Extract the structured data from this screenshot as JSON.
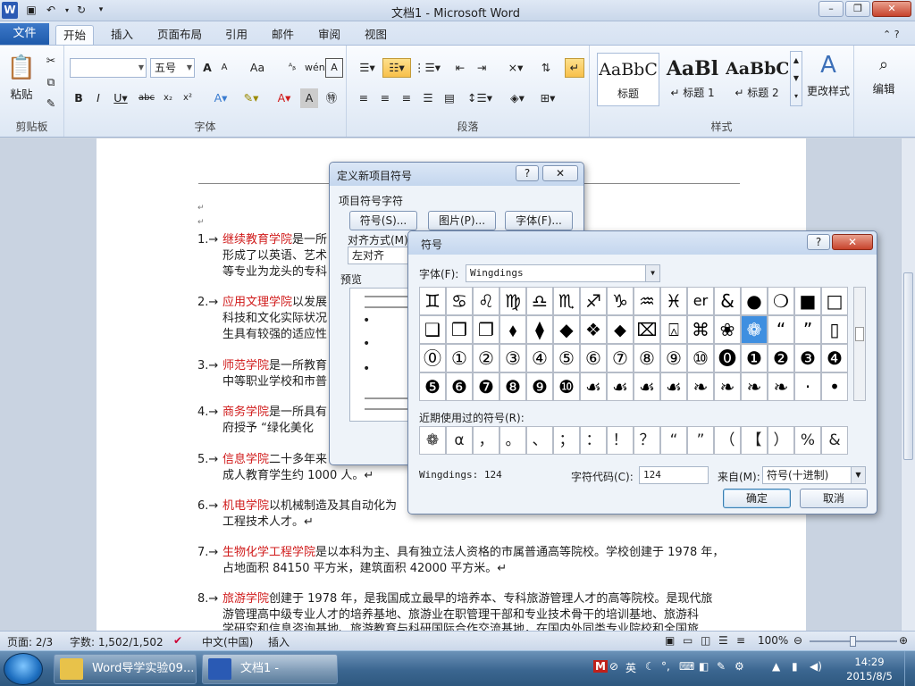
{
  "app": {
    "title": "文档1 - Microsoft Word",
    "file_tab": "文件",
    "tabs": [
      "开始",
      "插入",
      "页面布局",
      "引用",
      "邮件",
      "审阅",
      "视图"
    ]
  },
  "ribbon": {
    "clipboard": {
      "paste": "粘贴",
      "label": "剪贴板"
    },
    "font": {
      "size": "五号",
      "label": "字体"
    },
    "paragraph": {
      "label": "段落"
    },
    "styles": {
      "label": "样式",
      "items": [
        {
          "preview": "AaBbC",
          "name": "标题"
        },
        {
          "preview": "AaBl",
          "name": "↵ 标题 1"
        },
        {
          "preview": "AaBbC",
          "name": "↵ 标题 2"
        }
      ],
      "change": "更改样式"
    },
    "editing": {
      "label": "编辑"
    }
  },
  "document": {
    "paragraphs": [
      {
        "num": "1.→",
        "name": "继续教育学院",
        "lines": [
          "是一所",
          "形成了以英语、艺术",
          "等专业为龙头的专科"
        ]
      },
      {
        "num": "2.→",
        "name": "应用文理学院",
        "lines": [
          "以发展",
          "科技和文化实际状况",
          "生具有较强的适应性"
        ]
      },
      {
        "num": "3.→",
        "name": "师范学院",
        "lines": [
          "是一所教育",
          "中等职业学校和市普"
        ]
      },
      {
        "num": "4.→",
        "name": "商务学院",
        "lines": [
          "是一所具有",
          "府授予 “绿化美化"
        ]
      },
      {
        "num": "5.→",
        "name": "信息学院",
        "lines": [
          "二十多年来",
          "成人教育学生约 1000 人。↵"
        ]
      },
      {
        "num": "6.→",
        "name": "机电学院",
        "lines": [
          "以机械制造及其自动化为",
          "工程技术人才。↵"
        ]
      },
      {
        "num": "7.→",
        "name": "生物化学工程学院",
        "lines": [
          "是以本科为主、具有独立法人资格的市属普通高等院校。学校创建于 1978 年，",
          "占地面积 84150 平方米，建筑面积 42000 平方米。↵"
        ]
      },
      {
        "num": "8.→",
        "name": "旅游学院",
        "lines": [
          "创建于 1978 年，是我国成立最早的培养本、专科旅游管理人才的高等院校。是现代旅",
          "游管理高中级专业人才的培养基地、旅游业在职管理干部和专业技术骨干的培训基地、旅游科",
          "学研究和信息咨询基地、旅游教育与科研国际合作交流基地，在国内外同类专业院校和全国旅"
        ]
      }
    ]
  },
  "bullet_dialog": {
    "title": "定义新项目符号",
    "group_label": "项目符号字符",
    "symbol_button": "符号(S)...",
    "picture_button": "图片(P)...",
    "font_button": "字体(F)...",
    "align_label": "对齐方式(M)",
    "align_value": "左对齐",
    "preview_label": "预览"
  },
  "symbol_dialog": {
    "title": "符号",
    "font_label": "字体(F):",
    "font_value": "Wingdings",
    "grid": [
      [
        "♊",
        "♋",
        "♌",
        "♍",
        "♎",
        "♏",
        "♐",
        "♑",
        "♒",
        "♓",
        "er",
        "&",
        "●",
        "❍",
        "■",
        "□"
      ],
      [
        "❑",
        "❒",
        "❐",
        "⬧",
        "⧫",
        "◆",
        "❖",
        "⬥",
        "⌧",
        "⍓",
        "⌘",
        "❀",
        "❁",
        "“",
        "”",
        "▯"
      ],
      [
        "⓪",
        "①",
        "②",
        "③",
        "④",
        "⑤",
        "⑥",
        "⑦",
        "⑧",
        "⑨",
        "⑩",
        "⓿",
        "❶",
        "❷",
        "❸",
        "❹"
      ],
      [
        "❺",
        "❻",
        "❼",
        "❽",
        "❾",
        "❿",
        "☙",
        "☙",
        "☙",
        "☙",
        "❧",
        "❧",
        "❧",
        "❧",
        "·",
        "•"
      ]
    ],
    "selected_symbol": "❁",
    "recent_label": "近期使用过的符号(R):",
    "recent": [
      "❁",
      "α",
      "，",
      "。",
      "、",
      "；",
      "：",
      "！",
      "？",
      "“",
      "”",
      "（",
      "【",
      "）",
      "%",
      "&"
    ],
    "status_text": "Wingdings: 124",
    "code_label": "字符代码(C):",
    "code_value": "124",
    "from_label": "来自(M):",
    "from_value": "符号(十进制)",
    "ok": "确定",
    "cancel": "取消"
  },
  "statusbar": {
    "page": "页面: 2/3",
    "words": "字数: 1,502/1,502",
    "language": "中文(中国)",
    "mode": "插入",
    "zoom": "100%"
  },
  "taskbar": {
    "items": [
      "Word导学实验09...",
      "文档1 - Microso..."
    ],
    "ime": "英",
    "time": "14:29",
    "date": "2015/8/5"
  },
  "colors": {
    "ribbon_accent": "#1e5aab",
    "selected_cell": "#3f8fe0",
    "school_name": "#d01b1b"
  }
}
